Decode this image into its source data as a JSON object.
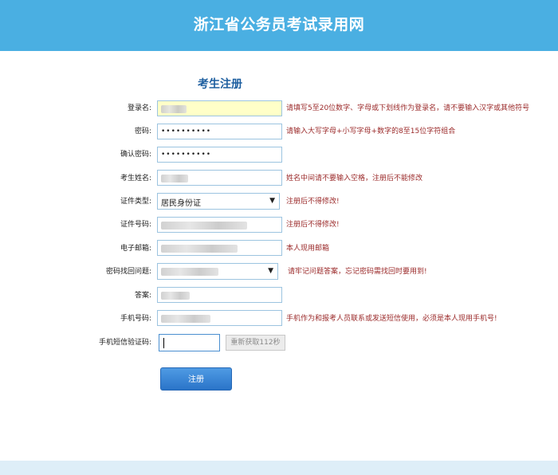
{
  "header": {
    "title": "浙江省公务员考试录用网"
  },
  "form": {
    "title": "考生注册",
    "fields": {
      "login_name": {
        "label": "登录名:",
        "hint": "请填写5至20位数字、字母或下划线作为登录名，请不要输入汉字或其他符号"
      },
      "password": {
        "label": "密码:",
        "value": "••••••••••",
        "hint": "请输入大写字母+小写字母+数字的8至15位字符组合"
      },
      "confirm_password": {
        "label": "确认密码:",
        "value": "••••••••••"
      },
      "name": {
        "label": "考生姓名:",
        "hint": "姓名中间请不要输入空格，注册后不能修改"
      },
      "id_type": {
        "label": "证件类型:",
        "value": "居民身份证",
        "hint": "注册后不得修改!"
      },
      "id_number": {
        "label": "证件号码:",
        "hint": "注册后不得修改!"
      },
      "email": {
        "label": "电子邮箱:",
        "hint": "本人现用邮箱"
      },
      "security_question": {
        "label": "密码找回问题:",
        "hint": "请牢记问题答案，忘记密码需找回时要用到!"
      },
      "answer": {
        "label": "答案:"
      },
      "phone": {
        "label": "手机号码:",
        "hint": "手机作为和报考人员联系或发送短信使用，必须是本人现用手机号!"
      },
      "sms_code": {
        "label": "手机短信验证码:"
      }
    },
    "resend_button": "重新获取112秒",
    "submit_button": "注册"
  },
  "colors": {
    "header_bg": "#4aafe2",
    "hint_text": "#9b2a2a",
    "title_text": "#1e5fa0",
    "submit_bg": "#2a74c8"
  }
}
